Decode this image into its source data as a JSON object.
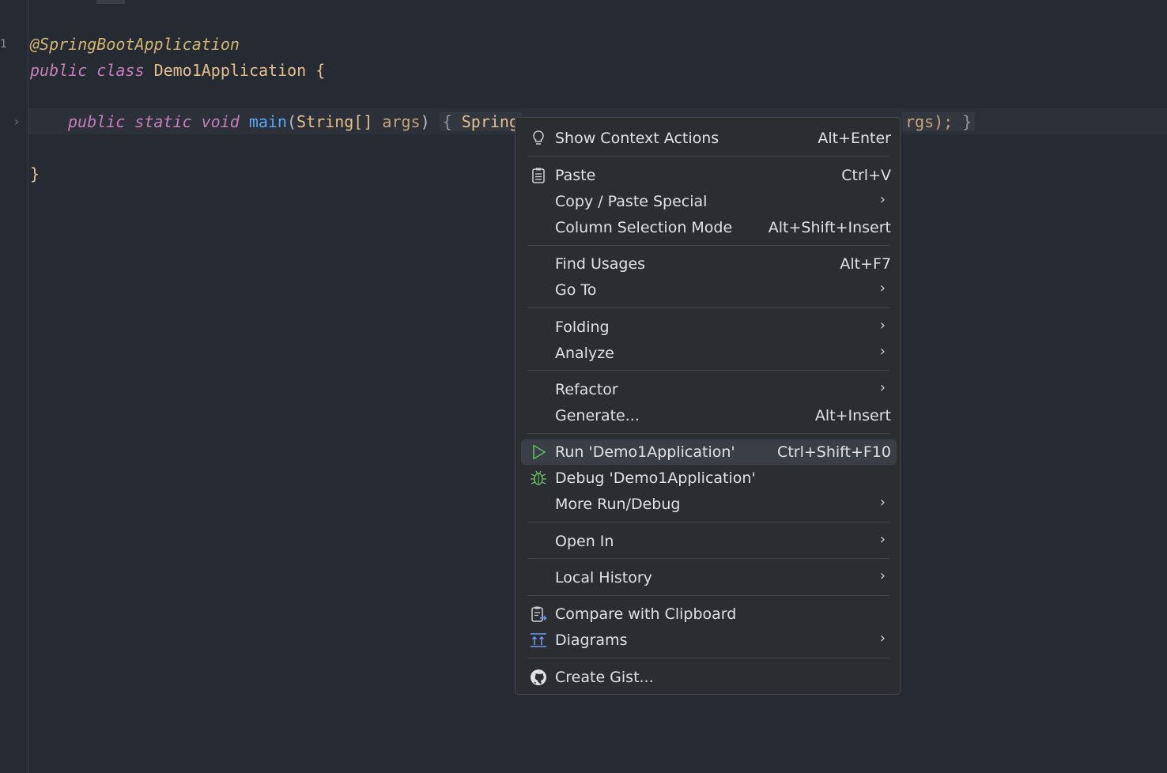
{
  "editor": {
    "gutter_mark": "1",
    "top_hint": "·",
    "fold_arrow": "›",
    "line1": "@SpringBootApplication",
    "line2": {
      "kw1": "public",
      "kw2": "class",
      "name": "Demo1Application",
      "brace": "{"
    },
    "line3": {
      "kw1": "public",
      "kw2": "static",
      "kw3": "void",
      "fn": "main",
      "p_open": "(",
      "type": "String[]",
      "arg": "args",
      "p_close": ")",
      "fold_open": "{",
      "visible_start": "Spring",
      "visible_end": "rgs);",
      "fold_close": "}"
    },
    "line4": "}"
  },
  "context_menu": {
    "items": [
      {
        "label": "Show Context Actions",
        "shortcut": "Alt+Enter",
        "icon": "lightbulb-icon"
      },
      {
        "label": "Paste",
        "shortcut": "Ctrl+V",
        "icon": "clipboard-icon"
      },
      {
        "label": "Copy / Paste Special",
        "shortcut": "",
        "submenu": true
      },
      {
        "label": "Column Selection Mode",
        "shortcut": "Alt+Shift+Insert"
      },
      {
        "label": "Find Usages",
        "shortcut": "Alt+F7"
      },
      {
        "label": "Go To",
        "shortcut": "",
        "submenu": true
      },
      {
        "label": "Folding",
        "shortcut": "",
        "submenu": true
      },
      {
        "label": "Analyze",
        "shortcut": "",
        "submenu": true
      },
      {
        "label": "Refactor",
        "shortcut": "",
        "submenu": true
      },
      {
        "label": "Generate...",
        "shortcut": "Alt+Insert"
      },
      {
        "label": "Run 'Demo1Application'",
        "shortcut": "Ctrl+Shift+F10",
        "icon": "run-icon",
        "selected": true
      },
      {
        "label": "Debug 'Demo1Application'",
        "shortcut": "",
        "icon": "bug-icon"
      },
      {
        "label": "More Run/Debug",
        "shortcut": "",
        "submenu": true
      },
      {
        "label": "Open In",
        "shortcut": "",
        "submenu": true
      },
      {
        "label": "Local History",
        "shortcut": "",
        "submenu": true
      },
      {
        "label": "Compare with Clipboard",
        "shortcut": "",
        "icon": "compare-clipboard-icon"
      },
      {
        "label": "Diagrams",
        "shortcut": "",
        "submenu": true,
        "icon": "diagrams-icon"
      },
      {
        "label": "Create Gist...",
        "shortcut": "",
        "icon": "github-icon"
      }
    ],
    "submenu_arrow": "›"
  },
  "colors": {
    "background": "#262a33",
    "menu_background": "#2b2d30",
    "selected_row": "#3a3e47",
    "run_green": "#5fb865"
  }
}
